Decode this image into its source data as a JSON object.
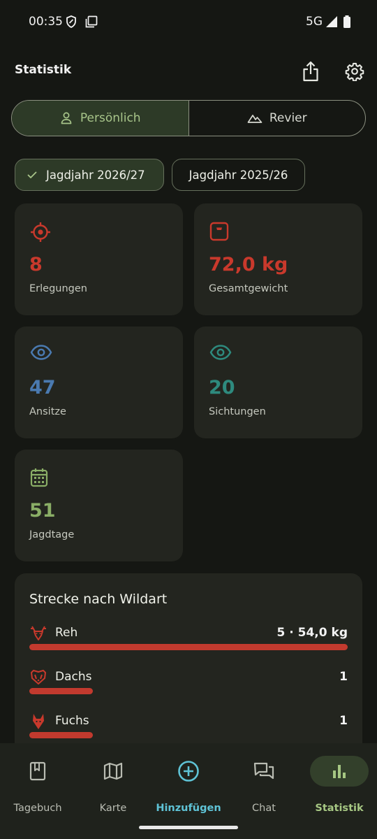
{
  "status_bar": {
    "time": "00:35",
    "network": "5G"
  },
  "app_bar": {
    "title": "Statistik"
  },
  "segmented": {
    "personal": "Persönlich",
    "territory": "Revier"
  },
  "chips": {
    "selected": "Jagdjahr 2026/27",
    "other": "Jagdjahr 2025/26"
  },
  "stats": [
    {
      "value": "8",
      "label": "Erlegungen",
      "color": "#c9392c",
      "icon": "target-icon"
    },
    {
      "value": "72,0 kg",
      "label": "Gesamtgewicht",
      "color": "#c9392c",
      "icon": "scale-icon"
    },
    {
      "value": "47",
      "label": "Ansitze",
      "color": "#4a7ab0",
      "icon": "eye-icon"
    },
    {
      "value": "20",
      "label": "Sichtungen",
      "color": "#2e8a7e",
      "icon": "eye-icon"
    },
    {
      "value": "51",
      "label": "Jagdtage",
      "color": "#8aae66",
      "icon": "calendar-icon"
    }
  ],
  "species": {
    "title": "Strecke nach Wildart",
    "items": [
      {
        "name": "Reh",
        "value": "5 · 54,0 kg",
        "share": 1.0,
        "icon": "deer-icon"
      },
      {
        "name": "Dachs",
        "value": "1",
        "share": 0.2,
        "icon": "badger-icon"
      },
      {
        "name": "Fuchs",
        "value": "1",
        "share": 0.2,
        "icon": "fox-icon"
      }
    ]
  },
  "nav": {
    "items": [
      {
        "label": "Tagebuch",
        "icon": "diary-icon"
      },
      {
        "label": "Karte",
        "icon": "map-icon"
      },
      {
        "label": "Hinzufügen",
        "icon": "add-circle-icon"
      },
      {
        "label": "Chat",
        "icon": "chat-icon"
      },
      {
        "label": "Statistik",
        "icon": "bar-chart-icon"
      }
    ],
    "active": "Statistik"
  },
  "colors": {
    "accent_green": "#a6c783",
    "add_cyan": "#5fc3d6",
    "bar_red": "#c23a2e"
  }
}
